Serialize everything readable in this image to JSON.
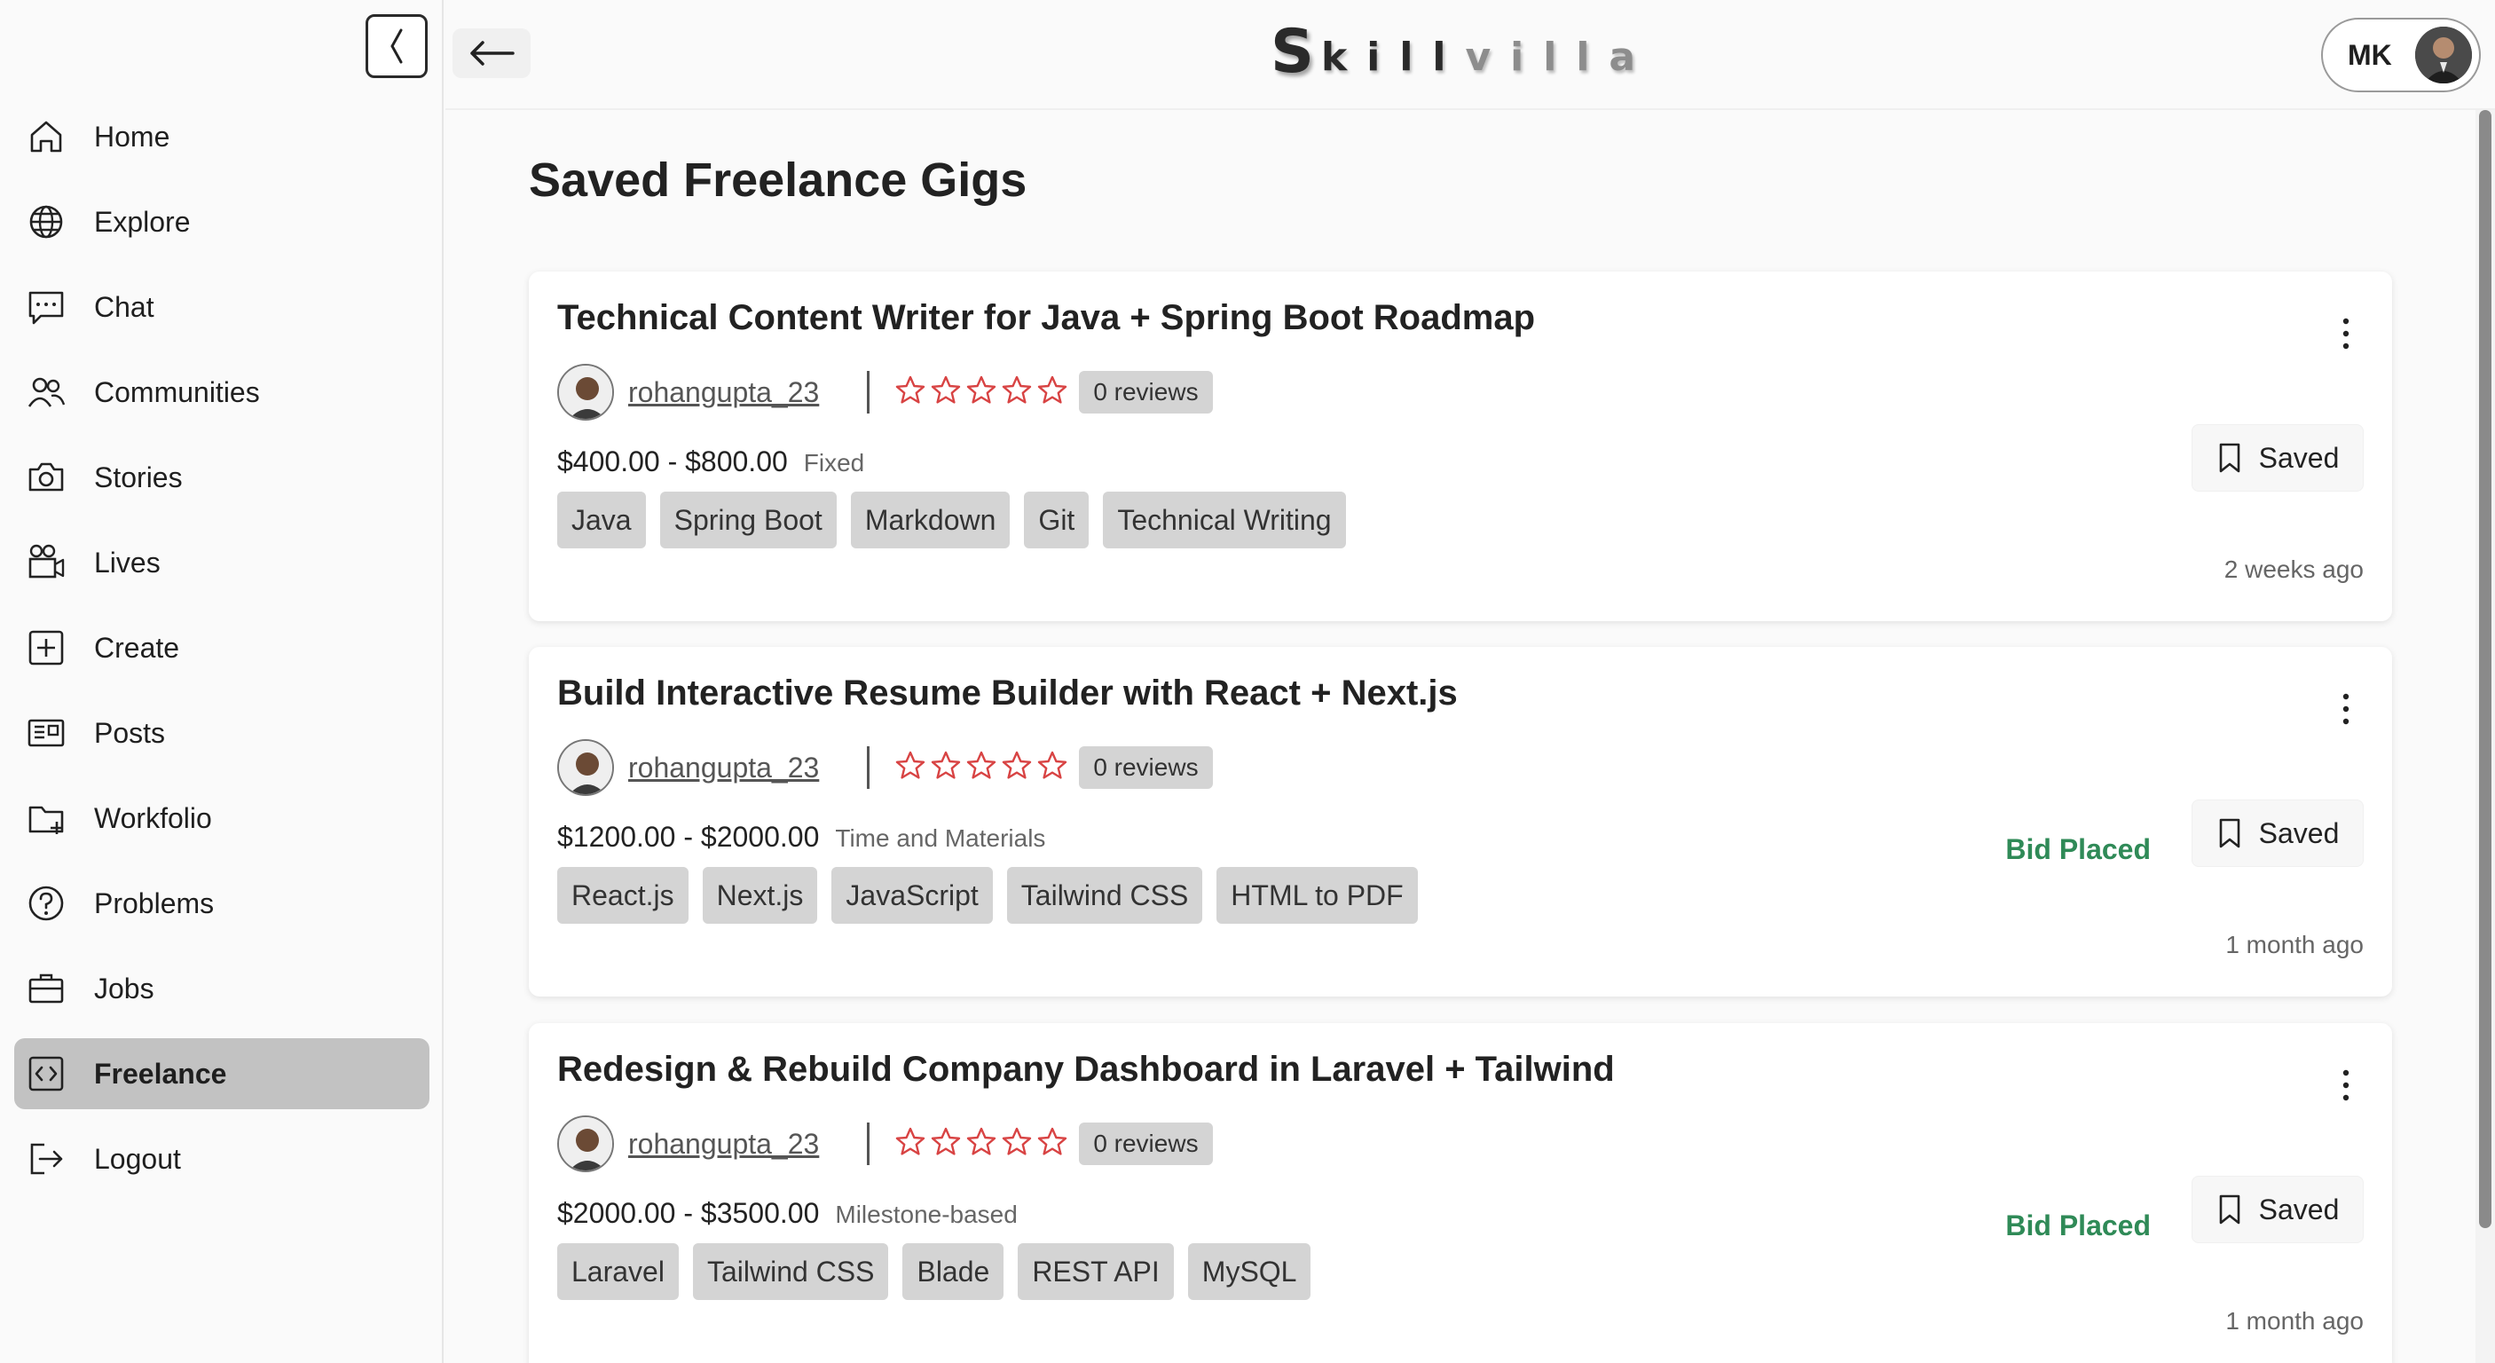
{
  "brand": {
    "logo_s": "S",
    "logo_dark": "kill",
    "logo_light": "villa"
  },
  "profile": {
    "initials": "MK"
  },
  "sidebar": {
    "items": [
      {
        "label": "Home",
        "icon": "home-icon"
      },
      {
        "label": "Explore",
        "icon": "globe-icon"
      },
      {
        "label": "Chat",
        "icon": "chat-icon"
      },
      {
        "label": "Communities",
        "icon": "users-icon"
      },
      {
        "label": "Stories",
        "icon": "camera-icon"
      },
      {
        "label": "Lives",
        "icon": "video-icon"
      },
      {
        "label": "Create",
        "icon": "plus-square-icon"
      },
      {
        "label": "Posts",
        "icon": "newspaper-icon"
      },
      {
        "label": "Workfolio",
        "icon": "folder-plus-icon"
      },
      {
        "label": "Problems",
        "icon": "help-circle-icon"
      },
      {
        "label": "Jobs",
        "icon": "briefcase-icon"
      },
      {
        "label": "Freelance",
        "icon": "code-square-icon",
        "active": true
      },
      {
        "label": "Logout",
        "icon": "logout-icon"
      }
    ]
  },
  "main": {
    "title": "Saved Freelance Gigs"
  },
  "gigs": [
    {
      "title": "Technical Content Writer for Java + Spring Boot Roadmap",
      "username": "rohangupta_23",
      "rating": 0,
      "reviews": "0 reviews",
      "price": "$400.00 - $800.00",
      "price_type": "Fixed",
      "tags": [
        "Java",
        "Spring Boot",
        "Markdown",
        "Git",
        "Technical Writing"
      ],
      "bid_status": "",
      "saved_label": "Saved",
      "posted": "2 weeks ago"
    },
    {
      "title": "Build Interactive Resume Builder with React + Next.js",
      "username": "rohangupta_23",
      "rating": 0,
      "reviews": "0 reviews",
      "price": "$1200.00 - $2000.00",
      "price_type": "Time and Materials",
      "tags": [
        "React.js",
        "Next.js",
        "JavaScript",
        "Tailwind CSS",
        "HTML to PDF"
      ],
      "bid_status": "Bid Placed",
      "saved_label": "Saved",
      "posted": "1 month ago"
    },
    {
      "title": "Redesign & Rebuild Company Dashboard in Laravel + Tailwind",
      "username": "rohangupta_23",
      "rating": 0,
      "reviews": "0 reviews",
      "price": "$2000.00 - $3500.00",
      "price_type": "Milestone-based",
      "tags": [
        "Laravel",
        "Tailwind CSS",
        "Blade",
        "REST API",
        "MySQL"
      ],
      "bid_status": "Bid Placed",
      "saved_label": "Saved",
      "posted": "1 month ago"
    }
  ],
  "colors": {
    "star_outline": "#d84343",
    "bid_placed": "#2f8a57",
    "active_nav": "#c2c2c2"
  }
}
